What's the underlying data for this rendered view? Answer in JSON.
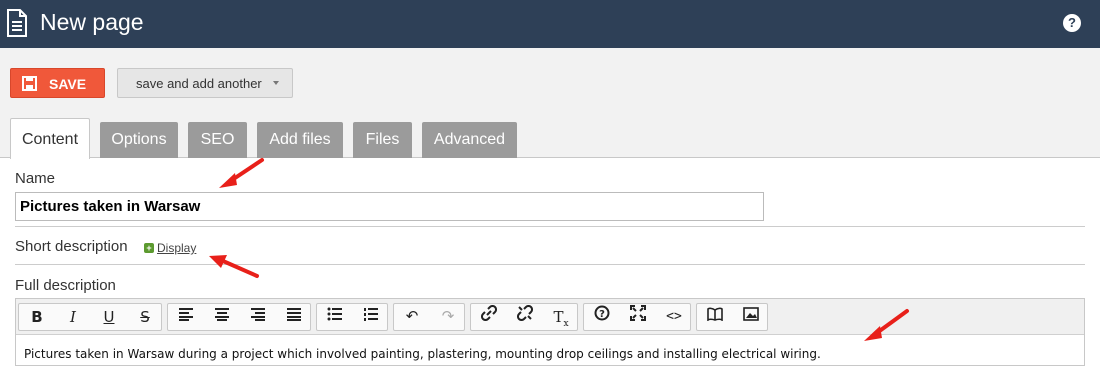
{
  "header": {
    "title": "New page",
    "help_label": "?"
  },
  "actions": {
    "save_label": "SAVE",
    "save_another_label": "save and add another"
  },
  "tabs": [
    {
      "label": "Content",
      "active": true
    },
    {
      "label": "Options",
      "active": false
    },
    {
      "label": "SEO",
      "active": false
    },
    {
      "label": "Add files",
      "active": false
    },
    {
      "label": "Files",
      "active": false
    },
    {
      "label": "Advanced",
      "active": false
    }
  ],
  "form": {
    "name_label": "Name",
    "name_value": "Pictures taken in Warsaw",
    "short_description_label": "Short description",
    "display_link": "Display",
    "full_description_label": "Full description"
  },
  "editor": {
    "content": "Pictures taken in Warsaw during a project which involved painting, plastering, mounting drop ceilings and installing electrical wiring."
  },
  "colors": {
    "header_bg": "#2e4057",
    "save_bg": "#f0583a",
    "tab_bg": "#9b9b9b",
    "arrow": "#e8201a"
  }
}
